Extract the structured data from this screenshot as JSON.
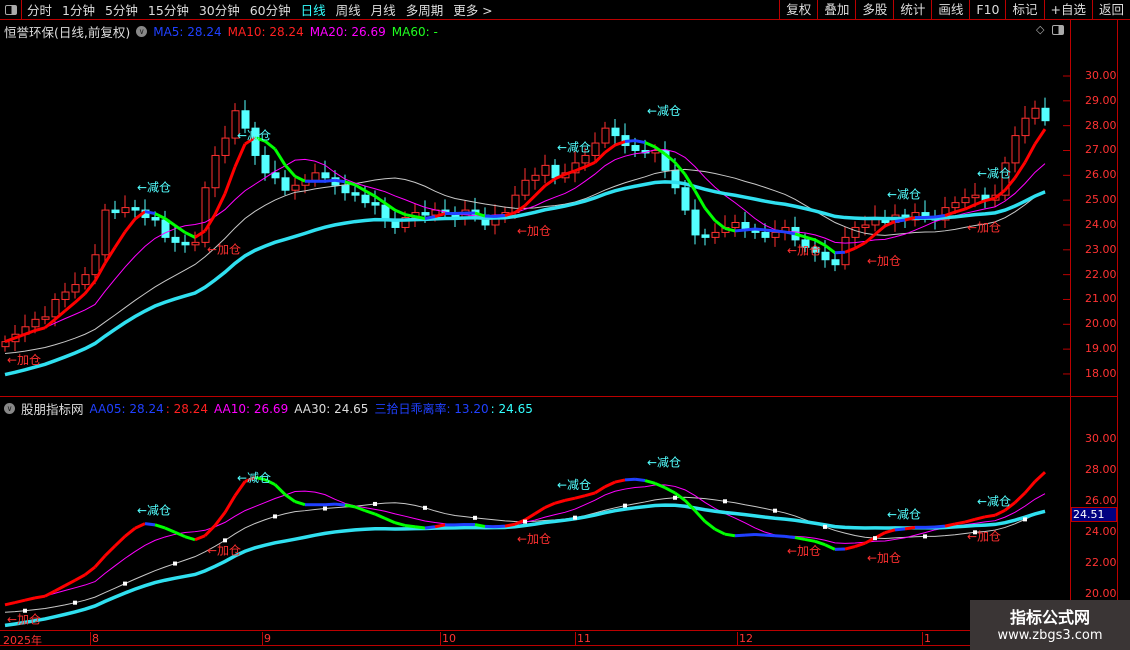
{
  "toolbar": {
    "periods": [
      "分时",
      "1分钟",
      "5分钟",
      "15分钟",
      "30分钟",
      "60分钟",
      "日线",
      "周线",
      "月线",
      "多周期",
      "更多 >"
    ],
    "active": "日线",
    "right_buttons": [
      "复权",
      "叠加",
      "多股",
      "统计",
      "画线",
      "F10",
      "标记",
      "+自选",
      "返回"
    ]
  },
  "main_legend": {
    "title": "恒誉环保(日线,前复权)",
    "ma5": "MA5: 28.24",
    "ma10": "MA10: 28.24",
    "ma20": "MA20: 26.69",
    "ma60": "MA60: -"
  },
  "sub_legend": {
    "title": "股朋指标网",
    "aa05": "AA05: 28.24",
    "aa05b": ": 28.24",
    "aa10": "AA10: 26.69",
    "aa30": "AA30: 24.65",
    "ratio": "三拾日乖离率: 13.20",
    "ratio_b": ": 24.65"
  },
  "colors": {
    "up": "#ff3030",
    "down": "#54ffff",
    "ma5_up": "#ff0000",
    "ma5_down": "#00ff00",
    "ma5_flat": "#2040ff",
    "ma10": "#ff00ff",
    "ma20": "#c8c8c8",
    "long": "#30e0f0",
    "plus": "#ff3030",
    "minus": "#54ffff"
  },
  "price_axis": [
    "30.00",
    "29.00",
    "28.00",
    "27.00",
    "26.00",
    "25.00",
    "24.00",
    "23.00",
    "22.00",
    "21.00",
    "20.00",
    "19.00",
    "18.00"
  ],
  "sub_axis": [
    "30.00",
    "28.00",
    "26.00",
    "24.00",
    "22.00",
    "20.00"
  ],
  "last_price": "24.51",
  "x_axis": [
    "2025年",
    "8",
    "9",
    "10",
    "11",
    "12",
    "1"
  ],
  "chart_data": {
    "type": "candlestick",
    "closes": [
      19.3,
      19.6,
      19.9,
      20.2,
      20.3,
      21.0,
      21.3,
      21.6,
      22.0,
      22.8,
      24.6,
      24.5,
      24.7,
      24.6,
      24.3,
      24.2,
      23.5,
      23.3,
      23.2,
      23.3,
      25.5,
      26.8,
      27.5,
      28.6,
      27.9,
      26.8,
      26.1,
      25.9,
      25.4,
      25.6,
      25.8,
      26.1,
      25.9,
      25.6,
      25.3,
      25.2,
      24.9,
      24.8,
      24.2,
      23.9,
      24.3,
      24.5,
      24.4,
      24.6,
      24.5,
      24.3,
      24.6,
      24.4,
      24.0,
      24.4,
      24.5,
      25.2,
      25.8,
      26.0,
      26.4,
      25.9,
      26.1,
      26.5,
      26.8,
      27.3,
      27.9,
      27.6,
      27.2,
      27.0,
      26.9,
      27.0,
      26.2,
      25.5,
      24.6,
      23.6,
      23.5,
      23.7,
      23.9,
      24.1,
      23.8,
      23.7,
      23.5,
      23.7,
      23.9,
      23.4,
      23.1,
      22.9,
      22.6,
      22.4,
      23.5,
      23.9,
      24.0,
      24.3,
      24.1,
      24.4,
      24.2,
      24.5,
      24.3,
      24.2,
      24.7,
      24.9,
      25.1,
      25.2,
      25.0,
      25.2,
      26.5,
      27.6,
      28.3,
      28.7,
      28.2
    ],
    "signals": [
      {
        "i": 0,
        "t": "←加仓"
      },
      {
        "i": 13,
        "t": "←减仓"
      },
      {
        "i": 20,
        "t": "←加仓"
      },
      {
        "i": 23,
        "t": "←减仓"
      },
      {
        "i": 51,
        "t": "←加仓"
      },
      {
        "i": 55,
        "t": "←减仓"
      },
      {
        "i": 64,
        "t": "←减仓"
      },
      {
        "i": 78,
        "t": "←加仓"
      },
      {
        "i": 86,
        "t": "←加仓"
      },
      {
        "i": 88,
        "t": "←减仓"
      },
      {
        "i": 96,
        "t": "←加仓"
      },
      {
        "i": 97,
        "t": "←减仓"
      }
    ],
    "ylim_main": [
      18,
      30
    ],
    "ylim_sub": [
      20,
      30
    ]
  },
  "watermark": {
    "name": "指标公式网",
    "url": "www.zbgs3.com"
  }
}
